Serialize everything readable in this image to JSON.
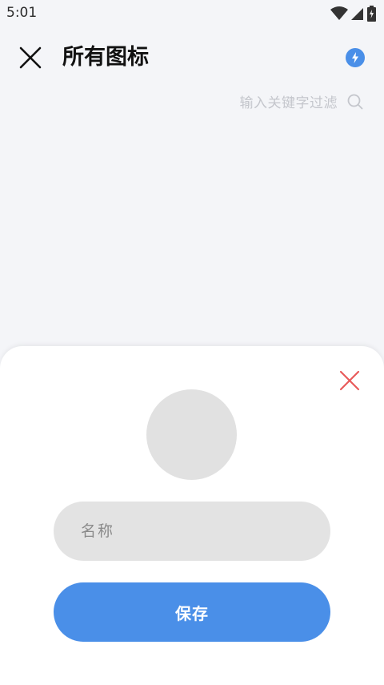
{
  "status_bar": {
    "time": "5:01",
    "icons": [
      "wifi-icon",
      "signal-icon",
      "battery-icon"
    ]
  },
  "app_bar": {
    "title": "所有图标",
    "close_icon": "close-icon",
    "action_icon": "flash-icon"
  },
  "filter": {
    "placeholder": "输入关键字过滤",
    "icon": "search-icon"
  },
  "sheet": {
    "close_icon": "close-icon",
    "name_placeholder": "名称",
    "name_value": "",
    "save_label": "保存"
  },
  "colors": {
    "accent": "#4a8fe8",
    "danger": "#e85a5a",
    "background": "#f4f5f8",
    "field": "#e3e3e3"
  }
}
